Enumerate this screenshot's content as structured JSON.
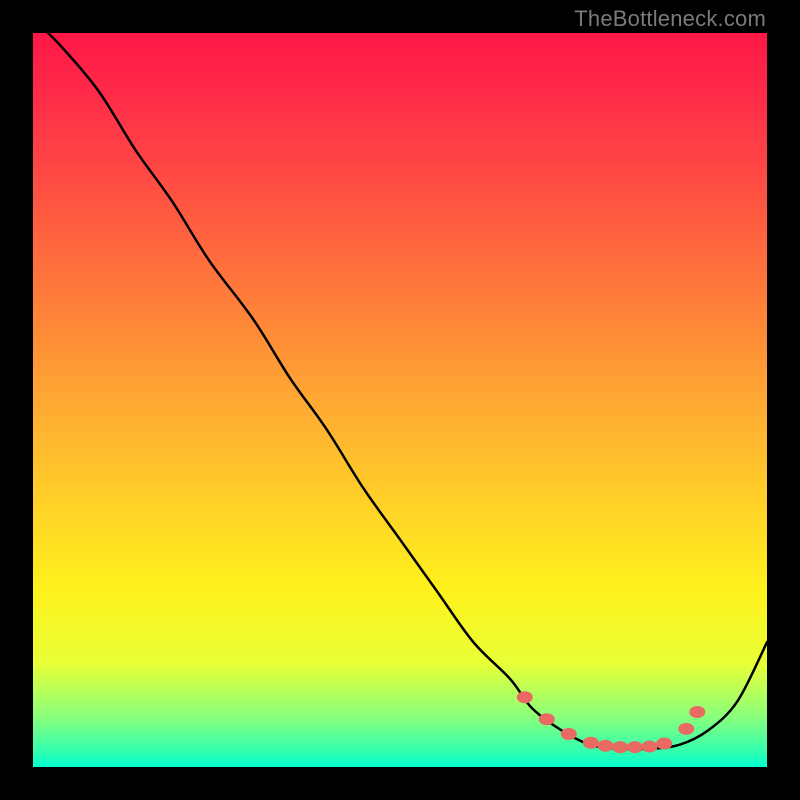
{
  "watermark": "TheBottleneck.com",
  "chart_data": {
    "type": "line",
    "title": "",
    "xlabel": "",
    "ylabel": "",
    "xlim": [
      0,
      100
    ],
    "ylim": [
      0,
      100
    ],
    "series": [
      {
        "name": "bottleneck-curve",
        "x": [
          0,
          4,
          9,
          14,
          19,
          24,
          30,
          35,
          40,
          45,
          50,
          55,
          60,
          65,
          68,
          72,
          76,
          80,
          84,
          88,
          92,
          96,
          100
        ],
        "y": [
          102,
          98,
          92,
          84,
          77,
          69,
          61,
          53,
          46,
          38,
          31,
          24,
          17,
          12,
          8,
          5,
          3,
          2.5,
          2.5,
          3,
          5,
          9,
          17
        ]
      }
    ],
    "markers": {
      "name": "highlight-dots",
      "color": "#e86a62",
      "x": [
        67,
        70,
        73,
        76,
        78,
        80,
        82,
        84,
        86,
        89,
        90.5
      ],
      "y": [
        9.5,
        6.5,
        4.5,
        3.3,
        2.9,
        2.7,
        2.7,
        2.8,
        3.2,
        5.2,
        7.5
      ]
    }
  }
}
